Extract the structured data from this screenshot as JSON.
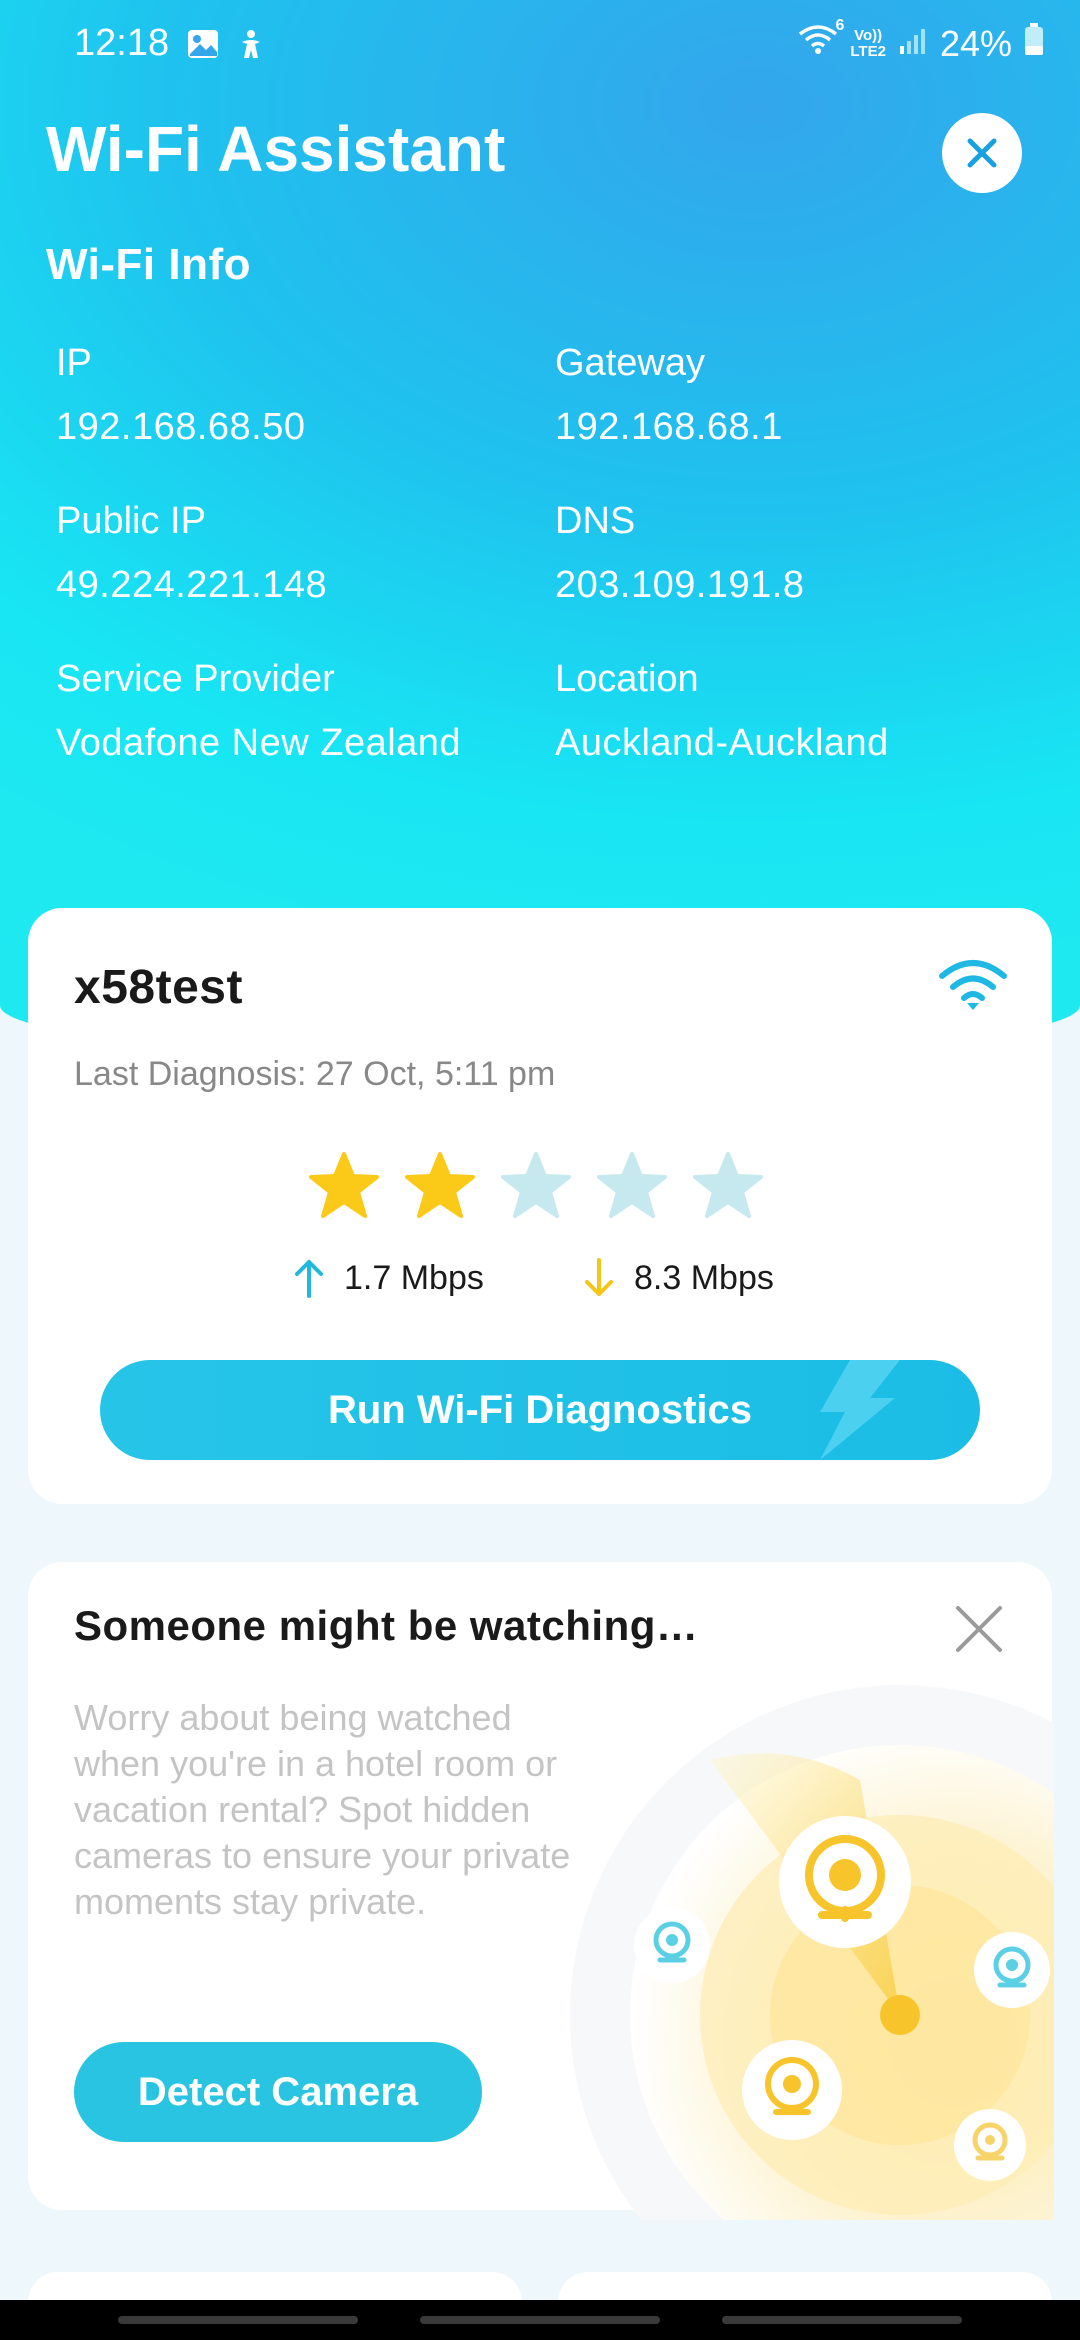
{
  "status_bar": {
    "time": "12:18",
    "battery": "24%",
    "network_label_top": "Vo))",
    "network_label_bottom": "LTE2",
    "wifi_badge": "6"
  },
  "header": {
    "title": "Wi-Fi Assistant",
    "close_icon": "close-icon"
  },
  "wifi_info": {
    "section_title": "Wi-Fi Info",
    "fields": [
      {
        "label": "IP",
        "value": "192.168.68.50"
      },
      {
        "label": "Gateway",
        "value": "192.168.68.1"
      },
      {
        "label": "Public IP",
        "value": "49.224.221.148"
      },
      {
        "label": "DNS",
        "value": "203.109.191.8"
      },
      {
        "label": "Service Provider",
        "value": "Vodafone New Zealand"
      },
      {
        "label": "Location",
        "value": "Auckland-Auckland"
      }
    ]
  },
  "network_card": {
    "name": "x58test",
    "last_diagnosis": "Last Diagnosis: 27 Oct, 5:11 pm",
    "rating": 2,
    "rating_max": 5,
    "upload": "1.7 Mbps",
    "download": "8.3 Mbps",
    "button_label": "Run Wi-Fi Diagnostics",
    "colors": {
      "star_on": "#fbc918",
      "star_off": "#c6e8ef",
      "upload_arrow": "#20b9dc",
      "download_arrow": "#f5c518"
    }
  },
  "promo_card": {
    "title": "Someone might be watching…",
    "description": "Worry about being watched when you're in a hotel room or vacation rental? Spot hidden cameras to ensure your private moments stay private.",
    "button_label": "Detect Camera"
  },
  "colors": {
    "accent": "#1fc2e8",
    "hero_top": "#33a6ec",
    "hero_bottom": "#1fe9f0"
  }
}
